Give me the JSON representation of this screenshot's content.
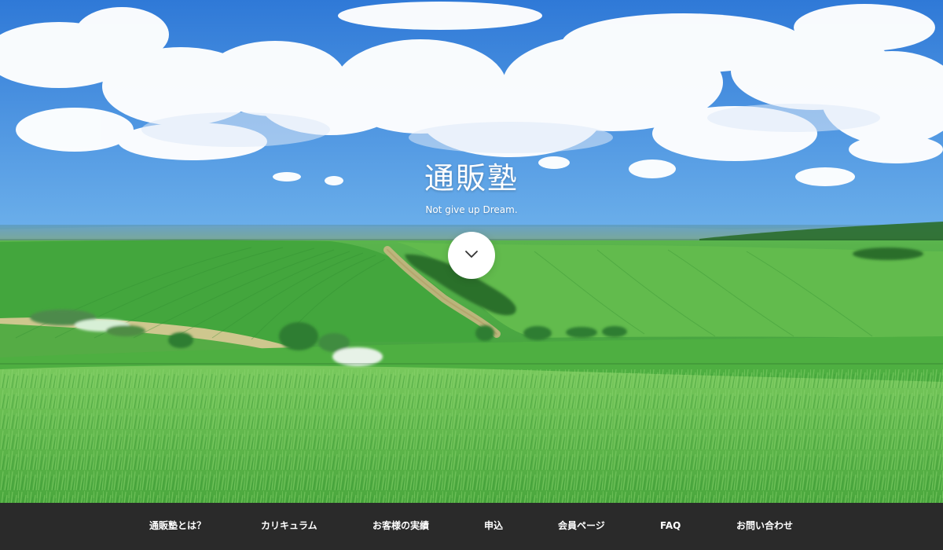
{
  "hero": {
    "title": "通販塾",
    "subtitle": "Not give up Dream.",
    "scroll_icon": "chevron-down-icon",
    "background_image": "sky-and-green-hills-landscape"
  },
  "nav": {
    "items": [
      "通販塾とは？",
      "カリキュラム",
      "お客様の実績",
      "申込",
      "会員ページ",
      "FAQ",
      "お問い合わせ"
    ]
  },
  "colors": {
    "nav_background": "#2a2a2a",
    "text": "#ffffff",
    "sky": "#5d9fe3",
    "grass": "#59b645"
  }
}
